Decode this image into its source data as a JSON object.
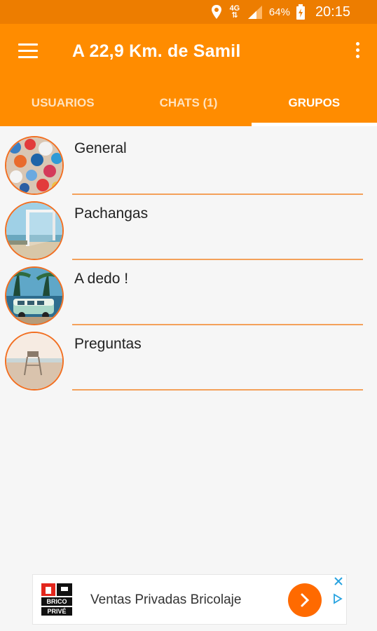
{
  "status_bar": {
    "network": "4G",
    "battery": "64%",
    "time": "20:15",
    "icons": [
      "location-pin-icon",
      "network-arrows-icon",
      "signal-icon",
      "battery-charging-icon"
    ]
  },
  "app_bar": {
    "title": "A 22,9 Km. de Samil",
    "menu_icon": "hamburger-menu-icon",
    "overflow_icon": "overflow-menu-icon"
  },
  "tabs": [
    {
      "label": "USUARIOS",
      "active": false
    },
    {
      "label": "CHATS (1)",
      "active": false
    },
    {
      "label": "GRUPOS",
      "active": true
    }
  ],
  "groups": [
    {
      "name": "General",
      "avatar": "umbrellas-image"
    },
    {
      "name": "Pachangas",
      "avatar": "beach-goal-image"
    },
    {
      "name": "A dedo !",
      "avatar": "van-palms-image"
    },
    {
      "name": "Preguntas",
      "avatar": "lifeguard-tower-image"
    }
  ],
  "ad": {
    "logo_text": [
      "BRICO",
      "PRIVÉ"
    ],
    "text": "Ventas Privadas Bricolaje"
  },
  "colors": {
    "primary": "#ff8c00",
    "primary_dark": "#ed7d00",
    "accent": "#f26f21"
  }
}
